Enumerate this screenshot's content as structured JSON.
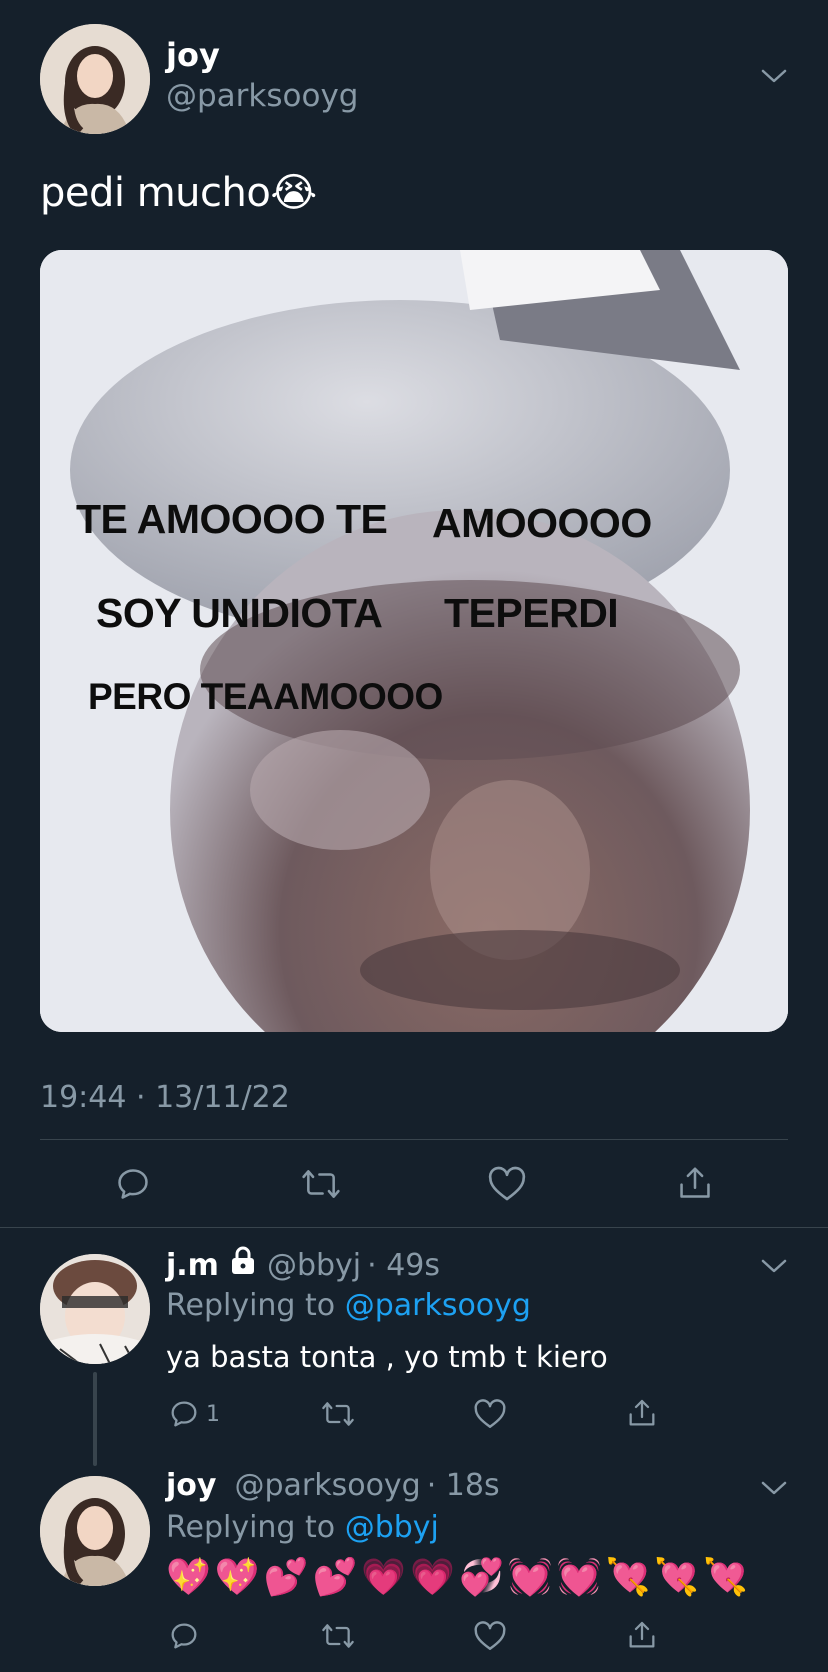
{
  "main_tweet": {
    "author_name": "joy",
    "author_handle": "@parksooyg",
    "text": "pedi mucho😭",
    "media_lines": [
      "TE AMOOOO TE",
      "AMOOOOO",
      "SOY UNIDIOTA",
      "TEPERDI",
      "PERO TEAAMOOOO"
    ],
    "timestamp": "19:44 · 13/11/22"
  },
  "replies": [
    {
      "author_name": "j.m",
      "author_handle": "@bbyj",
      "age": "· 49s",
      "replying_label": "Replying to",
      "replying_to": "@parksooyg",
      "text": "ya basta tonta , yo tmb t kiero",
      "reply_count": "1"
    },
    {
      "author_name": "joy",
      "author_handle": "@parksooyg",
      "age": "· 18s",
      "replying_label": "Replying to",
      "replying_to": "@bbyj",
      "emojis": [
        "💖",
        "💖",
        "💕",
        "💕",
        "💗",
        "💗",
        "💞",
        "💓",
        "💓",
        "💘",
        "💘",
        "💘"
      ]
    }
  ],
  "icons": {
    "reply": "reply-icon",
    "retweet": "retweet-icon",
    "like": "heart-icon",
    "share": "share-icon",
    "more": "chevron-down-icon",
    "lock": "lock-icon"
  },
  "colors": {
    "background": "#15202b",
    "muted": "#8899a6",
    "accent": "#1da1f2",
    "divider": "#38444d"
  }
}
